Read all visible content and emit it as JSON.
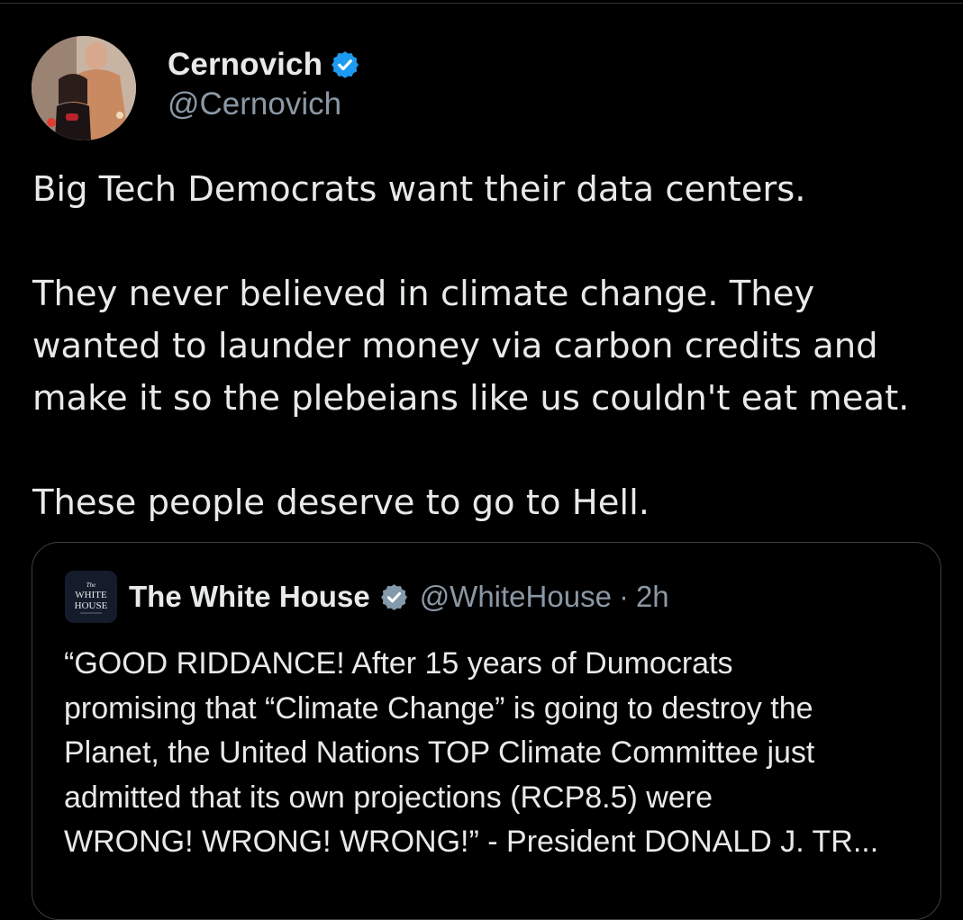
{
  "tweet": {
    "author": {
      "display_name": "Cernovich",
      "handle": "@Cernovich",
      "verified_icon": "blue-verified-badge-icon"
    },
    "text_lines": [
      "Big Tech Democrats want their data centers.",
      "They never believed in climate change. They",
      "wanted to launder money via carbon credits and",
      "make it so the plebeians like us couldn't eat meat.",
      "These people deserve to go to Hell."
    ]
  },
  "quote": {
    "author": {
      "display_name": "The White House",
      "handle": "@WhiteHouse",
      "separator": "·",
      "time": "2h",
      "verified_icon": "gray-government-verified-badge-icon",
      "avatar_text": [
        "The",
        "WHITE",
        "HOUSE"
      ]
    },
    "text_lines": [
      "“GOOD RIDDANCE! After 15 years of Dumocrats",
      "promising that “Climate Change” is going to destroy the",
      "Planet, the United Nations TOP Climate Committee just",
      "admitted that its own projections (RCP8.5) were",
      "WRONG! WRONG! WRONG!” - President DONALD J. TR..."
    ]
  },
  "colors": {
    "background": "#000000",
    "primary_text": "#e7e9ea",
    "secondary_text": "#8b98a5",
    "verified_blue": "#1d9bf0",
    "government_gray": "#829aab",
    "border": "#3a3f44"
  }
}
